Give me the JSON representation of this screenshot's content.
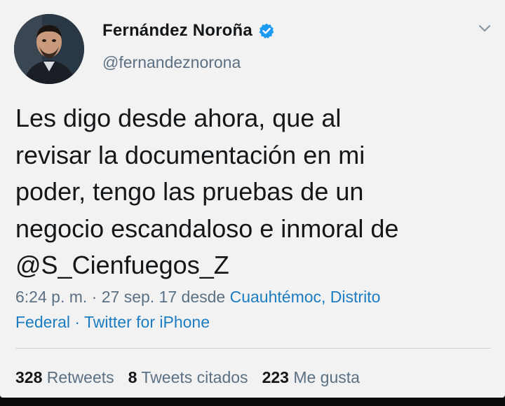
{
  "tweet": {
    "display_name": "Fernández Noroña",
    "handle": "@fernandeznorona",
    "text_lines": [
      "Les digo desde ahora, que al",
      "revisar la documentación en mi",
      "poder, tengo las pruebas de un",
      "negocio escandaloso e inmoral de",
      "@S_Cienfuegos_Z"
    ],
    "meta": {
      "time": "6:24 p. m.",
      "sep1": " · ",
      "date": "27 sep. 17",
      "from": " desde ",
      "location_line1": "Cuauhtémoc, Distrito",
      "location_line2": "Federal",
      "sep2": " · ",
      "source": "Twitter for iPhone"
    },
    "stats": {
      "retweets_count": "328",
      "retweets_label": "Retweets",
      "quotes_count": "8",
      "quotes_label": "Tweets citados",
      "likes_count": "223",
      "likes_label": "Me gusta"
    }
  },
  "icons": {
    "verified": "verified-badge-icon",
    "more": "chevron-down-icon"
  },
  "colors": {
    "background": "#f2f2f2",
    "text": "#14171a",
    "secondary": "#5b7083",
    "link": "#1b7cc1",
    "verified": "#1d9bf0"
  }
}
